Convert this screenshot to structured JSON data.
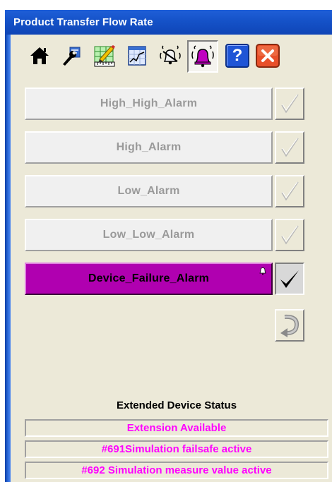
{
  "window": {
    "title": "Product Transfer Flow Rate"
  },
  "toolbar": {
    "icons": [
      "home-icon",
      "wrench-icon",
      "ruler-pencil-icon",
      "trend-chart-icon",
      "alarm-sound-icon",
      "alarm-bell-icon",
      "help-icon",
      "close-icon"
    ],
    "help_label": "?"
  },
  "alarms": [
    {
      "label": "High_High_Alarm",
      "active": false,
      "acknowledged": false
    },
    {
      "label": "High_Alarm",
      "active": false,
      "acknowledged": false
    },
    {
      "label": "Low_Alarm",
      "active": false,
      "acknowledged": false
    },
    {
      "label": "Low_Low_Alarm",
      "active": false,
      "acknowledged": false
    },
    {
      "label": "Device_Failure_Alarm",
      "active": true,
      "acknowledged": true
    }
  ],
  "colors": {
    "active_alarm": "#b000b0",
    "status_text": "#ff00ff",
    "titlebar": "#1552c8"
  },
  "extended_status": {
    "title": "Extended Device Status",
    "rows": [
      "Extension Available",
      "#691Simulation failsafe active",
      "#692 Simulation measure value active"
    ]
  }
}
